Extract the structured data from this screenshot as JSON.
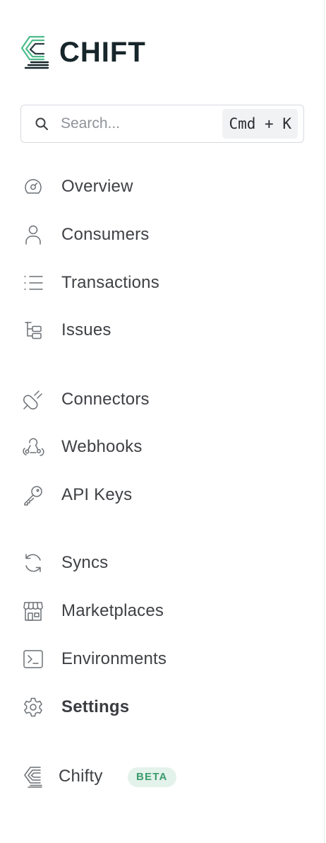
{
  "brand": {
    "name": "CHIFT",
    "icon": "chift-logo-icon",
    "color": "#17262b",
    "accent": "#4dbb8a"
  },
  "search": {
    "placeholder": "Search...",
    "shortcut": "Cmd + K"
  },
  "nav": {
    "overview": {
      "label": "Overview",
      "icon": "gauge-icon"
    },
    "consumers": {
      "label": "Consumers",
      "icon": "user-icon"
    },
    "transactions": {
      "label": "Transactions",
      "icon": "list-icon"
    },
    "issues": {
      "label": "Issues",
      "icon": "tree-icon"
    },
    "connectors": {
      "label": "Connectors",
      "icon": "plug-icon"
    },
    "webhooks": {
      "label": "Webhooks",
      "icon": "webhook-icon"
    },
    "api_keys": {
      "label": "API Keys",
      "icon": "key-icon"
    },
    "syncs": {
      "label": "Syncs",
      "icon": "refresh-icon"
    },
    "marketplaces": {
      "label": "Marketplaces",
      "icon": "store-icon"
    },
    "environments": {
      "label": "Environments",
      "icon": "terminal-icon"
    },
    "settings": {
      "label": "Settings",
      "icon": "gear-icon",
      "active": true
    }
  },
  "chifty": {
    "label": "Chifty",
    "badge": "BETA",
    "icon": "chifty-icon",
    "badge_bg": "#e3f2ea",
    "badge_color": "#3b9b6d"
  }
}
